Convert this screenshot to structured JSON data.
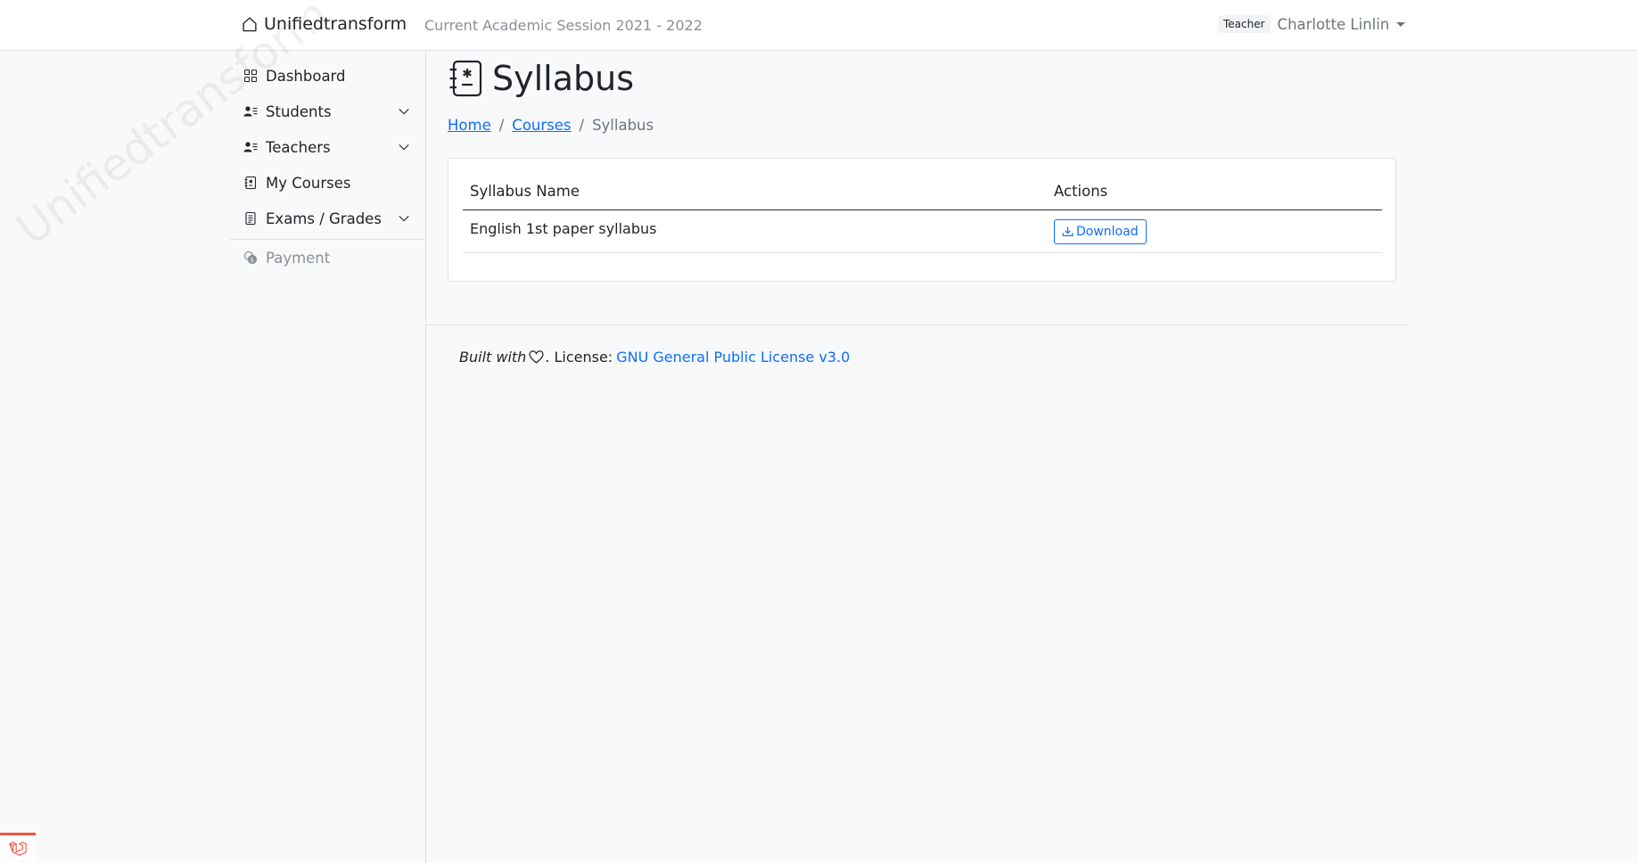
{
  "navbar": {
    "brand": "Unifiedtransform",
    "session": "Current Academic Session 2021 - 2022",
    "role": "Teacher",
    "user": "Charlotte Linlin"
  },
  "sidebar": {
    "watermark": "Unifiedtransform",
    "items": [
      {
        "label": "Dashboard",
        "icon": "grid-icon"
      },
      {
        "label": "Students",
        "icon": "person-lines-icon",
        "expandable": true
      },
      {
        "label": "Teachers",
        "icon": "person-lines-icon",
        "expandable": true
      },
      {
        "label": "My Courses",
        "icon": "journal-medical-icon"
      },
      {
        "label": "Exams / Grades",
        "icon": "file-text-icon",
        "expandable": true
      },
      {
        "label": "Payment",
        "icon": "coin-icon",
        "disabled": true
      }
    ]
  },
  "main": {
    "title": "Syllabus",
    "breadcrumb": {
      "home": "Home",
      "courses": "Courses",
      "current": "Syllabus",
      "separator": "/"
    },
    "table": {
      "headers": {
        "name": "Syllabus Name",
        "actions": "Actions"
      },
      "rows": [
        {
          "name": "English 1st paper syllabus",
          "action": "Download"
        }
      ]
    }
  },
  "footer": {
    "built_with": "Built with",
    "license_label": ". License:",
    "license_link": "GNU General Public License v3.0"
  },
  "colors": {
    "primary": "#0d6efd",
    "background": "#f8f9fa",
    "border": "#dee2e6",
    "laravel_red": "#f05340"
  }
}
